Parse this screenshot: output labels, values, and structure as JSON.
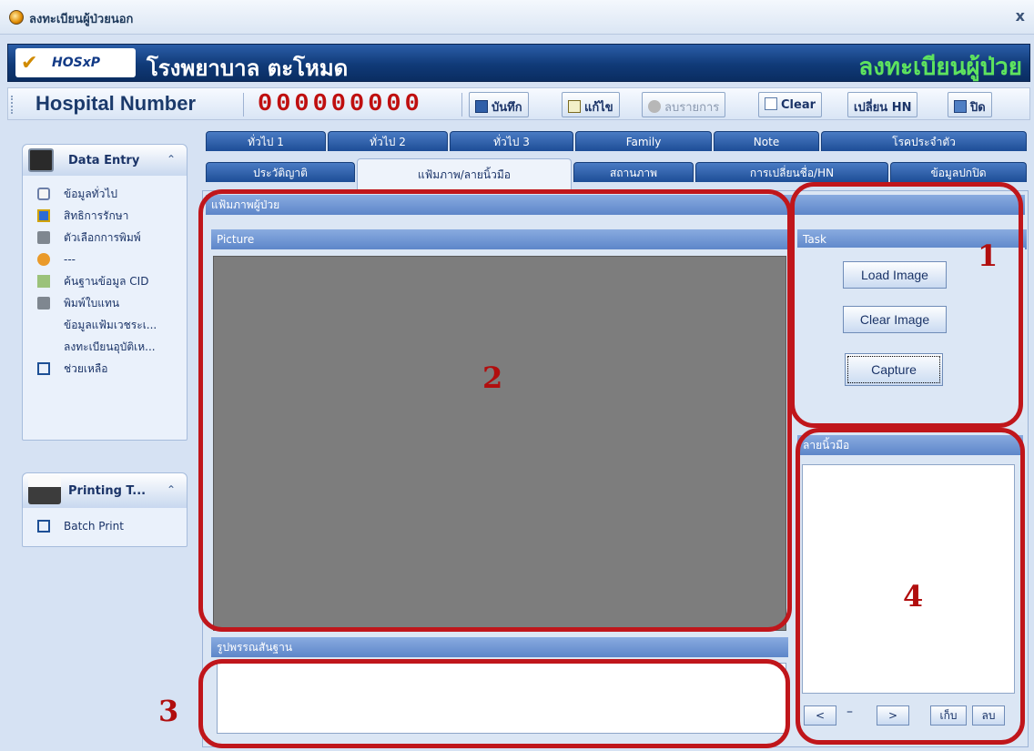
{
  "window": {
    "title": "ลงทะเบียนผู้ป่วยนอก",
    "close_glyph": "x"
  },
  "banner": {
    "logo_text": "HOSxP",
    "hospital_name": "โรงพยาบาล ตะโหมด",
    "module_title": "ลงทะเบียนผู้ป่วย"
  },
  "toolbar": {
    "hn_label": "Hospital Number",
    "hn_value": "000000000",
    "buttons": {
      "save": "บันทึก",
      "edit": "แก้ไข",
      "delete": "ลบรายการ",
      "clear": "Clear",
      "change_hn": "เปลี่ยน HN",
      "close": "ปิด"
    }
  },
  "sidebar": {
    "data_entry": {
      "title": "Data Entry",
      "chevron": "⌃",
      "items": [
        {
          "label": "ข้อมูลทั่วไป",
          "icon": "book-icon"
        },
        {
          "label": "สิทธิการรักษา",
          "icon": "card-icon"
        },
        {
          "label": "ตัวเลือกการพิมพ์",
          "icon": "printer-icon"
        },
        {
          "label": "---",
          "icon": "people-icon"
        },
        {
          "label": "ค้นฐานข้อมูล CID",
          "icon": "search-db-icon"
        },
        {
          "label": "พิมพ์ใบแทน",
          "icon": "printer-icon"
        },
        {
          "label": "ข้อมูลแฟ้มเวชระเ...",
          "icon": ""
        },
        {
          "label": "ลงทะเบียนอุบัติเห...",
          "icon": ""
        },
        {
          "label": "ช่วยเหลือ",
          "icon": "folder-icon"
        }
      ]
    },
    "printing": {
      "title": "Printing T...",
      "chevron": "⌃",
      "items": [
        {
          "label": "Batch Print",
          "icon": "folder-icon"
        }
      ]
    }
  },
  "tabs": {
    "row1": [
      "ทั่วไป 1",
      "ทั่วไป 2",
      "ทั่วไป 3",
      "Family",
      "Note",
      "โรคประจำตัว"
    ],
    "row2": [
      "ประวัติญาติ",
      "แฟ้มภาพ/ลายนิ้วมือ",
      "สถานภาพ",
      "การเปลี่ยนชื่อ/HN",
      "ข้อมูลปกปิด"
    ],
    "active": "แฟ้มภาพ/ลายนิ้วมือ"
  },
  "main": {
    "group_title": "แฟ้มภาพผู้ป่วย",
    "picture_header": "Picture",
    "task_header": "Task",
    "task_buttons": {
      "load": "Load Image",
      "clear": "Clear Image",
      "capture": "Capture"
    },
    "fingerprint_header": "ลายนิ้วมือ",
    "nav": {
      "prev": "<",
      "dash": "–",
      "next": ">",
      "save": "เก็บ",
      "delete": "ลบ"
    },
    "description_header": "รูปพรรณสันฐาน"
  },
  "annotations": [
    "1",
    "2",
    "3",
    "4"
  ],
  "colors": {
    "annotation": "#c0161b",
    "hn_value": "#bf0f0f",
    "module_title": "#5ee35e",
    "banner": "#103a78"
  }
}
